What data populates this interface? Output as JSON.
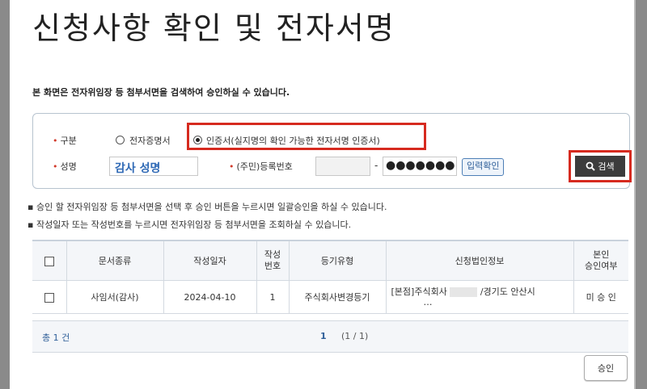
{
  "page_title": "신청사항 확인 및 전자서명",
  "description": "본 화면은 전자위임장 등 첨부서면을 검색하여 승인하실 수 있습니다.",
  "search": {
    "type_label": "구분",
    "option_e_cert": "전자증명서",
    "option_cert": "인증서(실지명의 확인 가능한 전자서명 인증서)",
    "selected_option": "인증서(실지명의 확인 가능한 전자서명 인증서)",
    "name_label": "성명",
    "name_value": "감사 성명",
    "rrn_label": "(주민)등록번호",
    "rrn_dash": "-",
    "rrn_back_masked": "●●●●●●●",
    "confirm_button": "입력확인",
    "search_button": "검색"
  },
  "notes": [
    "승인 할 전자위임장 등 첨부서면을 선택 후 승인 버튼을 누르시면 일괄승인을 하실 수 있습니다.",
    "작성일자 또는 작성번호를 누르시면 전자위임장 등 첨부서면을 조회하실 수 있습니다."
  ],
  "table": {
    "headers": {
      "doc_type": "문서종류",
      "date": "작성일자",
      "number": "작성 번호",
      "reg_type": "등기유형",
      "corp_info": "신청법인정보",
      "approval": "본인 승인여부"
    },
    "rows": [
      {
        "doc_type": "사임서(감사)",
        "date": "2024-04-10",
        "number": "1",
        "reg_type": "주식회사변경등기",
        "corp_info_prefix": "[본점]주식회사",
        "corp_info_suffix": "/경기도 안산시",
        "corp_info_more": "…",
        "approval": "미 승 인"
      }
    ]
  },
  "summary": {
    "total": "총 1 건",
    "current_page": "1",
    "page_info": "(1 / 1)"
  },
  "approve_button": "승인",
  "colors": {
    "highlight_red": "#d62a1f",
    "name_blue": "#2f69b5",
    "search_button_bg": "#3c3c3c"
  }
}
